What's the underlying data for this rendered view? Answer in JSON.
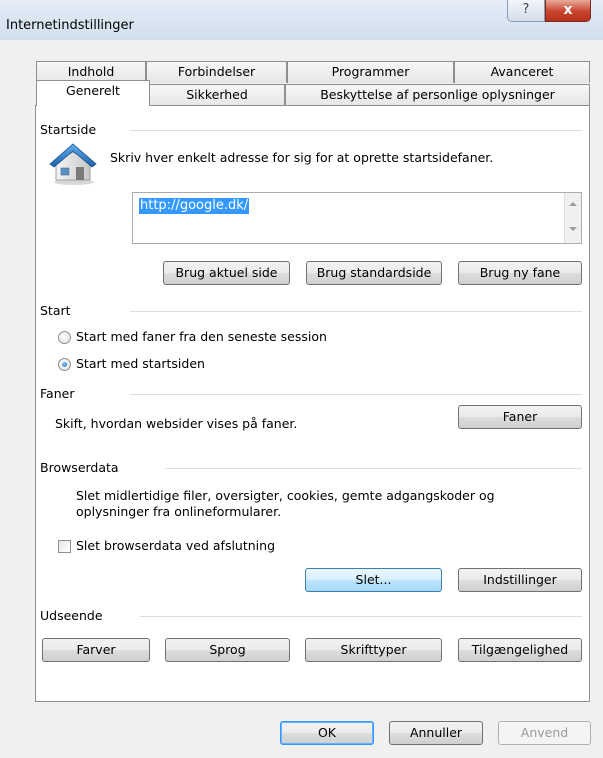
{
  "window": {
    "title": "Internetindstillinger",
    "help_glyph": "?",
    "close_glyph": "x"
  },
  "tabs": {
    "row1": [
      "Indhold",
      "Forbindelser",
      "Programmer",
      "Avanceret"
    ],
    "row2": [
      "Generelt",
      "Sikkerhed",
      "Beskyttelse af personlige oplysninger"
    ],
    "active": "Generelt"
  },
  "startside": {
    "title": "Startside",
    "description": "Skriv hver enkelt adresse for sig for at oprette startsidefaner.",
    "url": "http://google.dk/",
    "buttons": {
      "current": "Brug aktuel side",
      "default": "Brug standardside",
      "new_tab": "Brug ny fane"
    }
  },
  "start": {
    "title": "Start",
    "option_session": "Start med faner fra den seneste session",
    "option_homepage": "Start med startsiden",
    "selected": "option_homepage"
  },
  "faner": {
    "title": "Faner",
    "description": "Skift, hvordan websider vises på faner.",
    "button": "Faner"
  },
  "browserdata": {
    "title": "Browserdata",
    "description_line1": "Slet midlertidige filer, oversigter, cookies, gemte adgangskoder og",
    "description_line2": "oplysninger fra onlineformularer.",
    "checkbox_label": "Slet browserdata ved afslutning",
    "checkbox_checked": false,
    "delete_button": "Slet...",
    "settings_button": "Indstillinger"
  },
  "udseende": {
    "title": "Udseende",
    "buttons": [
      "Farver",
      "Sprog",
      "Skrifttyper",
      "Tilgængelighed"
    ]
  },
  "footer": {
    "ok": "OK",
    "cancel": "Annuller",
    "apply": "Anvend"
  },
  "colors": {
    "selection": "#3399ff",
    "hot_button": "#bee6fd",
    "close_button": "#c7432c"
  }
}
